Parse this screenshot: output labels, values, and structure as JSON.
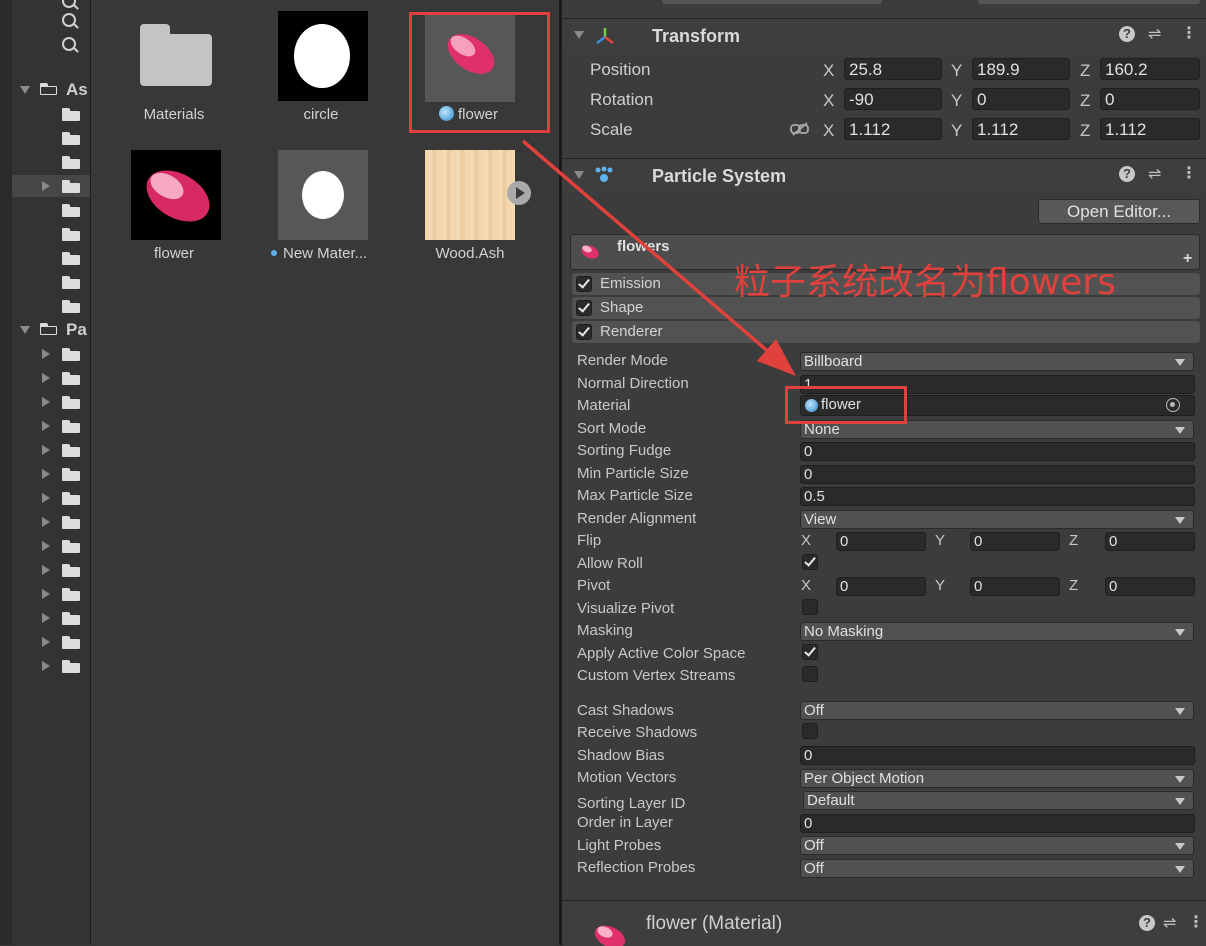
{
  "assets": {
    "items": [
      {
        "label": "Materials",
        "kind": "folder"
      },
      {
        "label": "circle",
        "kind": "texture"
      },
      {
        "label": "flower",
        "kind": "material"
      },
      {
        "label": "flower",
        "kind": "texture"
      },
      {
        "label": "New Mater...",
        "kind": "material"
      },
      {
        "label": "Wood.Ash",
        "kind": "texture"
      }
    ]
  },
  "tree": {
    "assets_label": "As",
    "packages_label": "Pa"
  },
  "transform": {
    "title": "Transform",
    "rows": [
      {
        "label": "Position",
        "x": "25.8",
        "y": "189.9",
        "z": "160.2"
      },
      {
        "label": "Rotation",
        "x": "-90",
        "y": "0",
        "z": "0"
      },
      {
        "label": "Scale",
        "x": "1.112",
        "y": "1.112",
        "z": "1.112"
      }
    ],
    "axis_x": "X",
    "axis_y": "Y",
    "axis_z": "Z"
  },
  "particle_system": {
    "title": "Particle System",
    "open_editor_label": "Open Editor...",
    "system_name": "flowers",
    "modules": [
      {
        "label": "Emission",
        "checked": true
      },
      {
        "label": "Shape",
        "checked": true
      },
      {
        "label": "Renderer",
        "checked": true
      }
    ]
  },
  "renderer": {
    "render_mode_label": "Render Mode",
    "render_mode_value": "Billboard",
    "normal_direction_label": "Normal Direction",
    "normal_direction_value": "1",
    "material_label": "Material",
    "material_value": "flower",
    "sort_mode_label": "Sort Mode",
    "sort_mode_value": "None",
    "sorting_fudge_label": "Sorting Fudge",
    "sorting_fudge_value": "0",
    "min_particle_size_label": "Min Particle Size",
    "min_particle_size_value": "0",
    "max_particle_size_label": "Max Particle Size",
    "max_particle_size_value": "0.5",
    "render_alignment_label": "Render Alignment",
    "render_alignment_value": "View",
    "flip_label": "Flip",
    "flip_x": "0",
    "flip_y": "0",
    "flip_z": "0",
    "allow_roll_label": "Allow Roll",
    "allow_roll_checked": true,
    "pivot_label": "Pivot",
    "pivot_x": "0",
    "pivot_y": "0",
    "pivot_z": "0",
    "visualize_pivot_label": "Visualize Pivot",
    "visualize_pivot_checked": false,
    "masking_label": "Masking",
    "masking_value": "No Masking",
    "apply_active_color_space_label": "Apply Active Color Space",
    "apply_active_color_space_checked": true,
    "custom_vertex_streams_label": "Custom Vertex Streams",
    "custom_vertex_streams_checked": false,
    "cast_shadows_label": "Cast Shadows",
    "cast_shadows_value": "Off",
    "receive_shadows_label": "Receive Shadows",
    "receive_shadows_checked": false,
    "shadow_bias_label": "Shadow Bias",
    "shadow_bias_value": "0",
    "motion_vectors_label": "Motion Vectors",
    "motion_vectors_value": "Per Object Motion",
    "sorting_layer_id_label": "Sorting Layer ID",
    "sorting_layer_id_value": "Default",
    "order_in_layer_label": "Order in Layer",
    "order_in_layer_value": "0",
    "light_probes_label": "Light Probes",
    "light_probes_value": "Off",
    "reflection_probes_label": "Reflection Probes",
    "reflection_probes_value": "Off"
  },
  "material_footer": {
    "title": "flower (Material)"
  },
  "annotation": {
    "text": "粒子系统改名为flowers",
    "color": "#e0413c"
  },
  "icons": {
    "help": "?",
    "settings": "⇌",
    "more": "⋮",
    "plus": "+",
    "play": "▶",
    "target": "⊙"
  }
}
